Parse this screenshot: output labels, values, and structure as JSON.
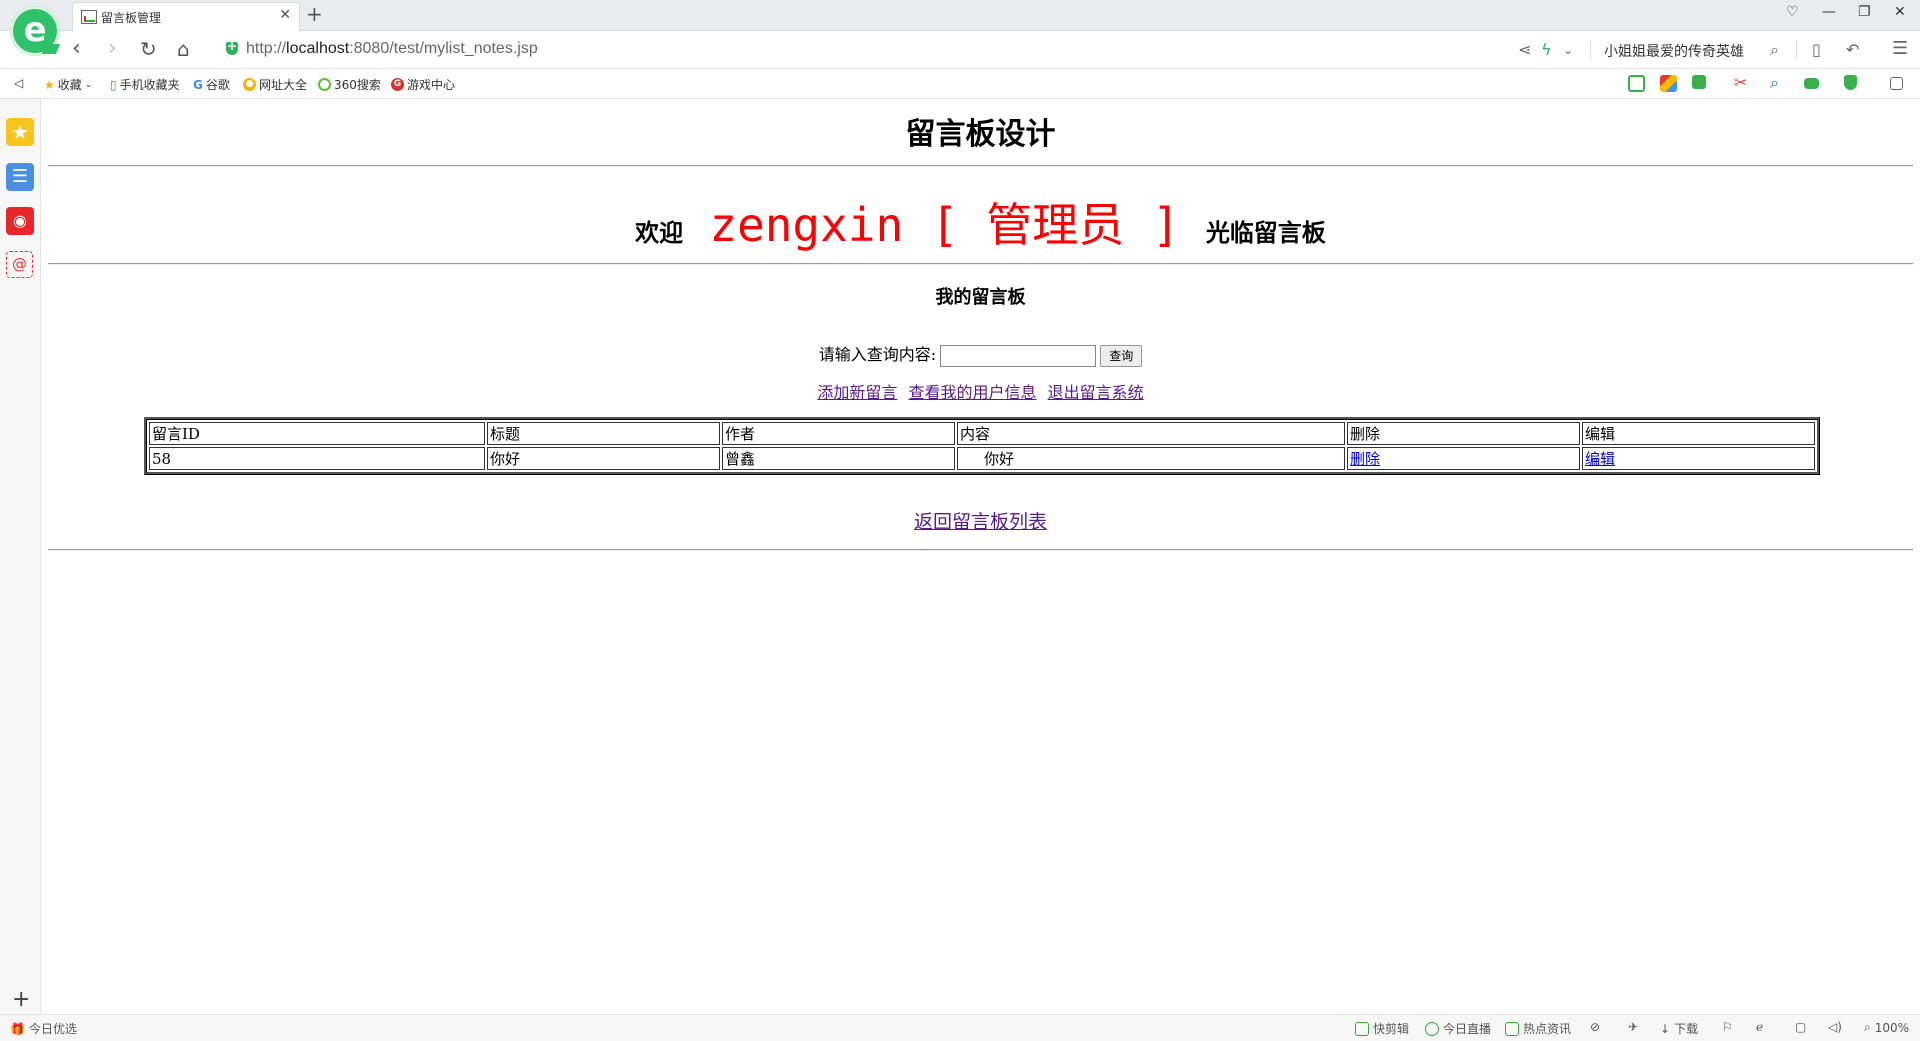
{
  "browser": {
    "tab_title": "留言板管理",
    "url_prefix": "http://",
    "url_host": "localhost",
    "url_rest": ":8080/test/mylist_notes.jsp",
    "search_promo": "小姐姐最爱的传奇英雄",
    "bookmarks": [
      "收藏",
      "手机收藏夹",
      "谷歌",
      "网址大全",
      "360搜索",
      "游戏中心"
    ],
    "status_left": "今日优选",
    "status_items": [
      "快剪辑",
      "今日直播",
      "热点资讯",
      "下载"
    ],
    "zoom": "100%"
  },
  "page": {
    "title": "留言板设计",
    "welcome_prefix": "欢迎",
    "username": "zengxin",
    "role": "[ 管理员 ]",
    "welcome_suffix": "光临留言板",
    "subheading": "我的留言板",
    "query_label": "请输入查询内容:",
    "query_value": "",
    "query_button": "查询",
    "links": [
      "添加新留言",
      "查看我的用户信息",
      "退出留言系统"
    ],
    "table": {
      "headers": [
        "留言ID",
        "标题",
        "作者",
        "内容",
        "删除",
        "编辑"
      ],
      "rows": [
        {
          "id": "58",
          "title": "你好",
          "author": "曾鑫",
          "content": "你好",
          "delete": "删除",
          "edit": "编辑"
        }
      ]
    },
    "back_link": "返回留言板列表"
  },
  "colors": {
    "welcome_accent": "#ff0000",
    "link_visited": "#551a8b",
    "link": "#0000ee",
    "brand_green": "#2fc26b"
  }
}
